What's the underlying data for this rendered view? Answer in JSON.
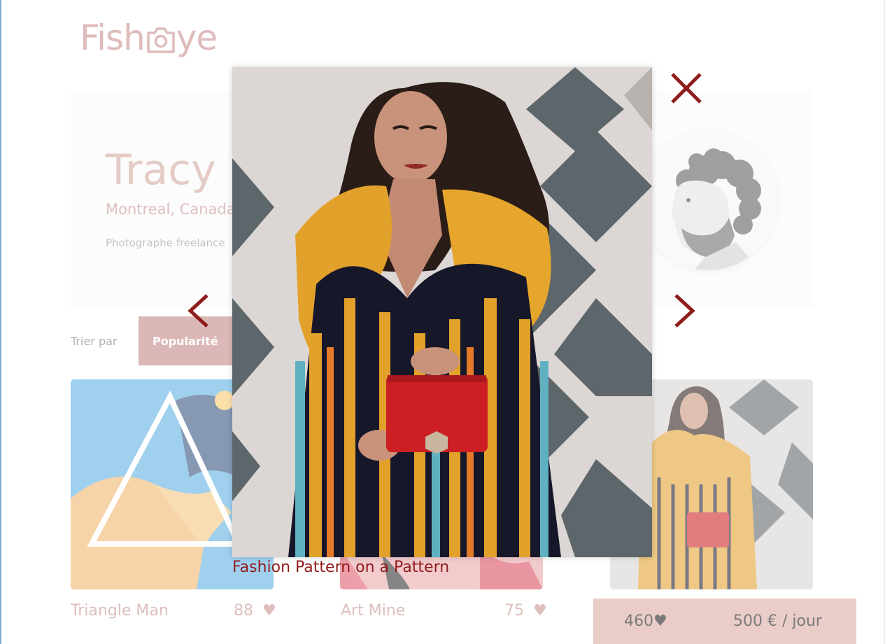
{
  "logo": {
    "text_left": "Fish",
    "text_right": "ye",
    "icon": "camera-icon"
  },
  "photographer": {
    "name": "Tracy",
    "location": "Montreal, Canada",
    "tagline": "Photographe freelance",
    "avatar_icon": "portrait-photo"
  },
  "sort": {
    "label": "Trier par",
    "selected": "Popularité"
  },
  "gallery": [
    {
      "title": "Triangle Man",
      "likes": "88"
    },
    {
      "title": "Art Mine",
      "likes": "75"
    },
    {
      "title": "",
      "likes": ""
    }
  ],
  "heart_glyph": "♥",
  "footer_stats": {
    "total_likes": "460",
    "rate": "500 € / jour"
  },
  "lightbox": {
    "title": "Fashion Pattern on a Pattern",
    "close_icon": "close-icon",
    "prev_icon": "chevron-left-icon",
    "next_icon": "chevron-right-icon"
  },
  "colors": {
    "brand": "#c68c8a",
    "accent_dark": "#901c1c",
    "sort_button": "#c18686",
    "price_bar": "#dba9a2"
  }
}
